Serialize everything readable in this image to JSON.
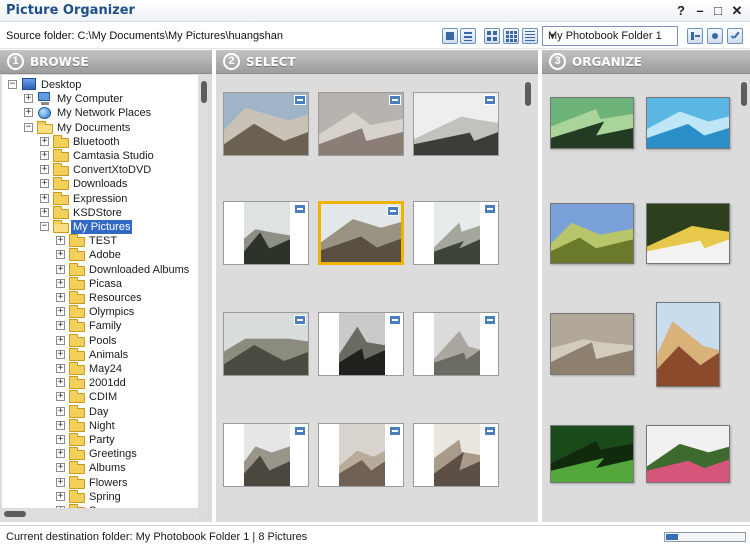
{
  "app": {
    "title": "Picture Organizer"
  },
  "window": {
    "help": "?",
    "minimize": "–",
    "maximize": "□",
    "close": "✕"
  },
  "toolbar": {
    "source_label": "Source folder: C:\\My Documents\\My Pictures\\huangshan",
    "destination_select": "My Photobook Folder 1"
  },
  "panels": {
    "browse": {
      "step": "1",
      "title": "BROWSE"
    },
    "select": {
      "step": "2",
      "title": "SELECT"
    },
    "organize": {
      "step": "3",
      "title": "ORGANIZE"
    }
  },
  "tree": [
    {
      "label": "Desktop",
      "icon": "desktop",
      "level": 0,
      "expander": "−"
    },
    {
      "label": "My Computer",
      "icon": "computer",
      "level": 1,
      "expander": "+"
    },
    {
      "label": "My Network Places",
      "icon": "network",
      "level": 1,
      "expander": "+"
    },
    {
      "label": "My Documents",
      "icon": "folder-open",
      "level": 1,
      "expander": "−"
    },
    {
      "label": "Bluetooth",
      "icon": "folder",
      "level": 2,
      "expander": "+"
    },
    {
      "label": "Camtasia Studio",
      "icon": "folder",
      "level": 2,
      "expander": "+"
    },
    {
      "label": "ConvertXtoDVD",
      "icon": "folder",
      "level": 2,
      "expander": "+"
    },
    {
      "label": "Downloads",
      "icon": "folder",
      "level": 2,
      "expander": "+"
    },
    {
      "label": "Expression",
      "icon": "folder",
      "level": 2,
      "expander": "+"
    },
    {
      "label": "KSDStore",
      "icon": "folder",
      "level": 2,
      "expander": "+"
    },
    {
      "label": "My Pictures",
      "icon": "folder-open",
      "level": 2,
      "expander": "−",
      "selected": true
    },
    {
      "label": "TEST",
      "icon": "folder",
      "level": 3,
      "expander": "+"
    },
    {
      "label": "Adobe",
      "icon": "folder",
      "level": 3,
      "expander": "+"
    },
    {
      "label": "Downloaded Albums",
      "icon": "folder",
      "level": 3,
      "expander": "+"
    },
    {
      "label": "Picasa",
      "icon": "folder",
      "level": 3,
      "expander": "+"
    },
    {
      "label": "Resources",
      "icon": "folder",
      "level": 3,
      "expander": "+"
    },
    {
      "label": "Olympics",
      "icon": "folder",
      "level": 3,
      "expander": "+"
    },
    {
      "label": "Family",
      "icon": "folder",
      "level": 3,
      "expander": "+"
    },
    {
      "label": "Pools",
      "icon": "folder",
      "level": 3,
      "expander": "+"
    },
    {
      "label": "Animals",
      "icon": "folder",
      "level": 3,
      "expander": "+"
    },
    {
      "label": "May24",
      "icon": "folder",
      "level": 3,
      "expander": "+"
    },
    {
      "label": "2001dd",
      "icon": "folder",
      "level": 3,
      "expander": "+"
    },
    {
      "label": "CDIM",
      "icon": "folder",
      "level": 3,
      "expander": "+"
    },
    {
      "label": "Day",
      "icon": "folder",
      "level": 3,
      "expander": "+"
    },
    {
      "label": "Night",
      "icon": "folder",
      "level": 3,
      "expander": "+"
    },
    {
      "label": "Party",
      "icon": "folder",
      "level": 3,
      "expander": "+"
    },
    {
      "label": "Greetings",
      "icon": "folder",
      "level": 3,
      "expander": "+"
    },
    {
      "label": "Albums",
      "icon": "folder",
      "level": 3,
      "expander": "+"
    },
    {
      "label": "Flowers",
      "icon": "folder",
      "level": 3,
      "expander": "+"
    },
    {
      "label": "Spring",
      "icon": "folder",
      "level": 3,
      "expander": "+"
    },
    {
      "label": "Summer",
      "icon": "folder",
      "level": 3,
      "expander": "+"
    }
  ],
  "select_photos": [
    {
      "name": "group-photo",
      "orientation": "landscape",
      "colors": [
        "#9fb4c6",
        "#6b6152",
        "#c8c2b6"
      ]
    },
    {
      "name": "mist-cliffs",
      "orientation": "landscape",
      "colors": [
        "#b9b3b0",
        "#8a7e76",
        "#d8d2cc"
      ]
    },
    {
      "name": "foggy-mountain",
      "orientation": "landscape",
      "colors": [
        "#eeeeee",
        "#3a3d38",
        "#bfc2bd"
      ]
    },
    {
      "name": "pine-tree",
      "orientation": "portrait",
      "colors": [
        "#dfe2e3",
        "#2d3328",
        "#8d8f84"
      ]
    },
    {
      "name": "boulder-peak",
      "orientation": "landscape",
      "colors": [
        "#e4e8ea",
        "#5a4f43",
        "#9a9282"
      ],
      "selected": true
    },
    {
      "name": "lone-pine",
      "orientation": "portrait",
      "colors": [
        "#e7ebec",
        "#3c4537",
        "#a5a79d"
      ]
    },
    {
      "name": "rock-spires",
      "orientation": "landscape",
      "colors": [
        "#d9dcdc",
        "#4a4a40",
        "#8b8b7e"
      ]
    },
    {
      "name": "dark-ridge",
      "orientation": "portrait",
      "colors": [
        "#c9cbcb",
        "#1f211d",
        "#6a6a62"
      ]
    },
    {
      "name": "misty-summit",
      "orientation": "portrait",
      "colors": [
        "#dcdcdc",
        "#6b6a63",
        "#a9a79f"
      ]
    },
    {
      "name": "stone-pinnacle",
      "orientation": "portrait",
      "colors": [
        "#e6e6e4",
        "#4b463e",
        "#9a9589"
      ]
    },
    {
      "name": "cliff-face",
      "orientation": "portrait",
      "colors": [
        "#d8d3cc",
        "#6f6254",
        "#b7ab9a"
      ]
    },
    {
      "name": "narrow-canyon",
      "orientation": "portrait",
      "colors": [
        "#eae6e0",
        "#5c5046",
        "#a89b8a"
      ]
    }
  ],
  "organize_photos": [
    {
      "name": "fantasy-valley",
      "colors": [
        "#6db37a",
        "#233b22",
        "#a9d59a"
      ]
    },
    {
      "name": "blue-info",
      "colors": [
        "#5ab6e3",
        "#2a8fc8",
        "#bfe6f7"
      ]
    },
    {
      "name": "field-path",
      "colors": [
        "#7aa0d8",
        "#697a2a",
        "#b9c56a"
      ]
    },
    {
      "name": "white-flower",
      "colors": [
        "#2e3f1e",
        "#f2f2f0",
        "#e8c84a"
      ]
    },
    {
      "name": "plaza-walk",
      "colors": [
        "#b1a89a",
        "#8d806f",
        "#d3cbbd"
      ]
    },
    {
      "name": "pagoda",
      "colors": [
        "#c9dcec",
        "#8a4a2b",
        "#d9b27a"
      ]
    },
    {
      "name": "green-leaves",
      "colors": [
        "#1b4a1a",
        "#54a83b",
        "#0f2a0d"
      ]
    },
    {
      "name": "pink-blossoms",
      "colors": [
        "#f1f1f1",
        "#d6557a",
        "#3d6b2f"
      ]
    }
  ],
  "status": {
    "text": "Current destination folder: My Photobook Folder 1  |  8 Pictures",
    "progress": 0.15
  }
}
